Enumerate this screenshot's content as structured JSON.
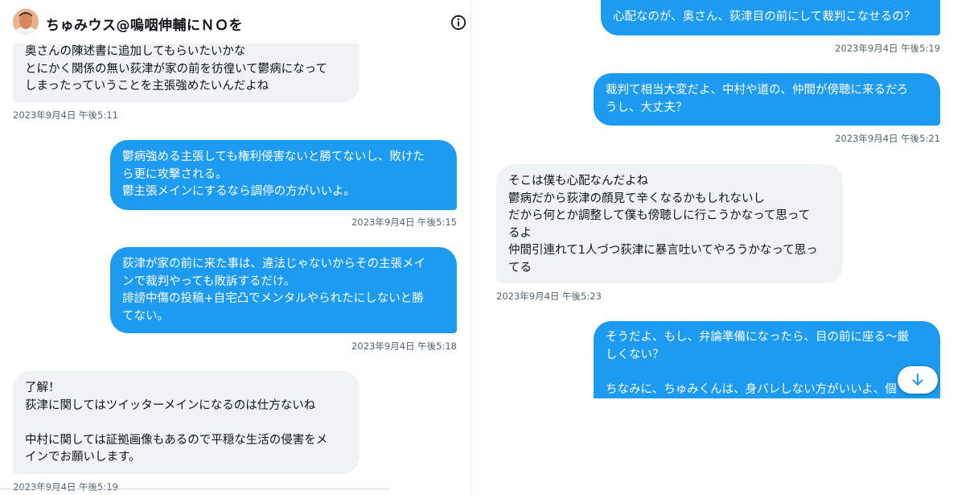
{
  "left": {
    "header": {
      "name": "ちゅみウス@嗚咽伸輔にＮＯを"
    },
    "messages": [
      {
        "text": "奥さんの陳述書に追加してもらいたいかな\nとにかく関係の無い荻津が家の前を彷徨いて鬱病になって\nしまったっていうことを主張強めたいんだよね",
        "time": "2023年9月4日 午後5:11"
      },
      {
        "text": "鬱病強める主張しても権利侵害ないと勝てないし、敗けた\nら更に攻撃される。\n鬱主張メインにするなら調停の方がいいよ。",
        "time": "2023年9月4日 午後5:15"
      },
      {
        "text": "荻津が家の前に来た事は、違法じゃないからその主張メイ\nンで裁判やっても敗訴するだけ。\n誹謗中傷の投稿+自宅凸でメンタルやられたにしないと勝\nてない。",
        "time": "2023年9月4日 午後5:18"
      },
      {
        "text": "了解！\n荻津に関してはツイッターメインになるのは仕方ないね\n\n中村に関しては証拠画像もあるので平穏な生活の侵害をメ\nインでお願いします。",
        "time": "2023年9月4日 午後5:19"
      }
    ]
  },
  "right": {
    "messages": [
      {
        "text": "心配なのが、奥さん、荻津目の前にして裁判こなせるの？",
        "time": "2023年9月4日 午後5:19"
      },
      {
        "text": "裁判て相当大変だよ、中村や道の、仲間が傍聴に来るだろ\nうし、大丈夫？",
        "time": "2023年9月4日 午後5:21"
      },
      {
        "text": "そこは僕も心配なんだよね\n鬱病だから荻津の顔見て辛くなるかもしれないし\nだから何とか調整して僕も傍聴しに行こうかなって思って\nるよ\n仲間引連れて1人づつ荻津に暴言吐いてやろうかなって思っ\nてる",
        "time": "2023年9月4日 午後5:23"
      },
      {
        "text": "そうだよ、もし、弁論準備になったら、目の前に座る〜厳\nしくない？\n\nちなみに、ちゅみくんは、身バレしない方がいいよ、個"
      }
    ]
  },
  "icons": {
    "info": "info-icon",
    "scroll_down": "arrow-down-icon"
  },
  "colors": {
    "sent_bubble": "#1d9bf0",
    "received_bubble": "#eff3f4",
    "timestamp": "#536471"
  }
}
